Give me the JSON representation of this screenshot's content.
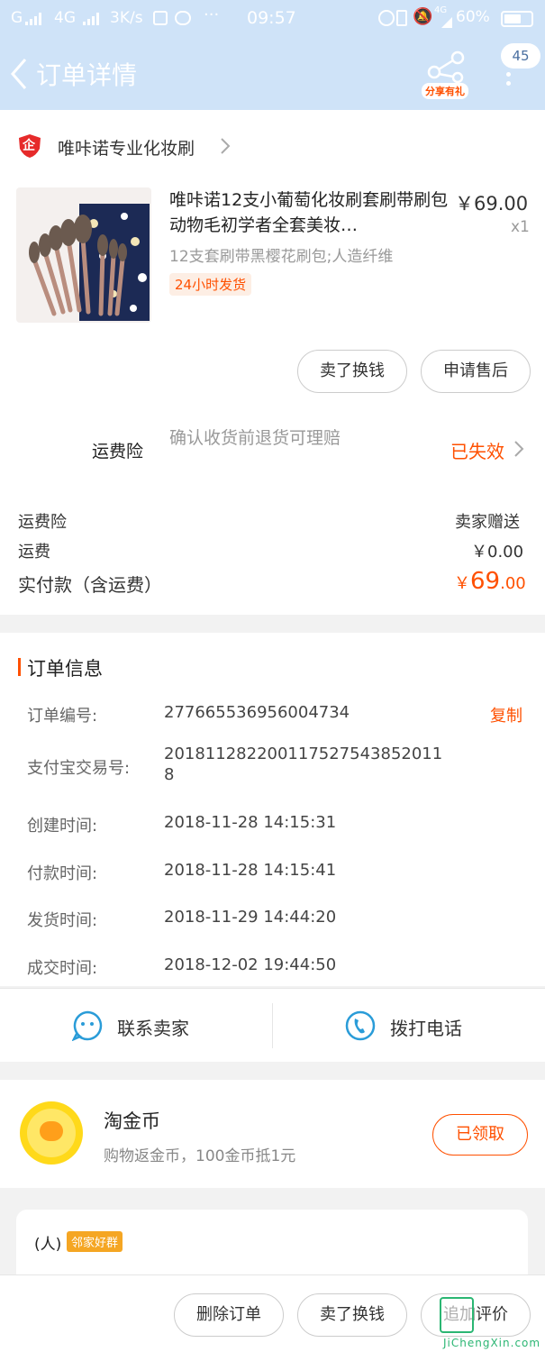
{
  "status_bar": {
    "signal": "G",
    "network": "4G",
    "speed": "3K/s",
    "time": "09:57",
    "battery": "60%",
    "net_small": "4G"
  },
  "nav": {
    "title": "订单详情",
    "share_label": "分享有礼",
    "badge_count": "45"
  },
  "shop": {
    "badge_char": "企",
    "name": "唯咔诺专业化妆刷"
  },
  "product": {
    "title": "唯咔诺12支小葡萄化妆刷套刷带刷包动物毛初学者全套美妆…",
    "price": "￥69.00",
    "qty": "x1",
    "sku": "12支套刷带黑樱花刷包;人造纤维",
    "tag": "24小时发货"
  },
  "item_actions": {
    "resell": "卖了换钱",
    "after_sale": "申请售后"
  },
  "insurance": {
    "label": "运费险",
    "desc": "确认收货前退货可理赔",
    "status": "已失效"
  },
  "costs": {
    "insurance_label": "运费险",
    "insurance_value": "卖家赠送",
    "shipping_label": "运费",
    "shipping_value": "￥0.00",
    "paid_label": "实付款（含运费）",
    "paid_symbol": "￥",
    "paid_int": "69",
    "paid_dec": ".00"
  },
  "order_info": {
    "title": "订单信息",
    "copy_label": "复制",
    "rows": [
      {
        "label": "订单编号:",
        "value": "277665536956004734"
      },
      {
        "label": "支付宝交易号:",
        "value": "201811282200117527543852011",
        "value2": "8"
      },
      {
        "label": "创建时间:",
        "value": "2018-11-28 14:15:31"
      },
      {
        "label": "付款时间:",
        "value": "2018-11-28 14:15:41"
      },
      {
        "label": "发货时间:",
        "value": "2018-11-29 14:44:20"
      },
      {
        "label": "成交时间:",
        "value": "2018-12-02 19:44:50"
      }
    ]
  },
  "contact": {
    "seller": "联系卖家",
    "phone": "拨打电话"
  },
  "coins": {
    "title": "淘金币",
    "desc": "购物返金币，100金币抵1元",
    "button": "已领取"
  },
  "group": {
    "prefix": "(人)",
    "tag": "邻家好群"
  },
  "bottom_bar": {
    "delete": "删除订单",
    "resell": "卖了换钱",
    "review": "追加评价"
  },
  "watermark": {
    "text": "JiChengXin.com"
  },
  "colors": {
    "accent": "#ff5000",
    "header_bg": "#cfe3f8",
    "icon_blue": "#2a9cd8"
  }
}
